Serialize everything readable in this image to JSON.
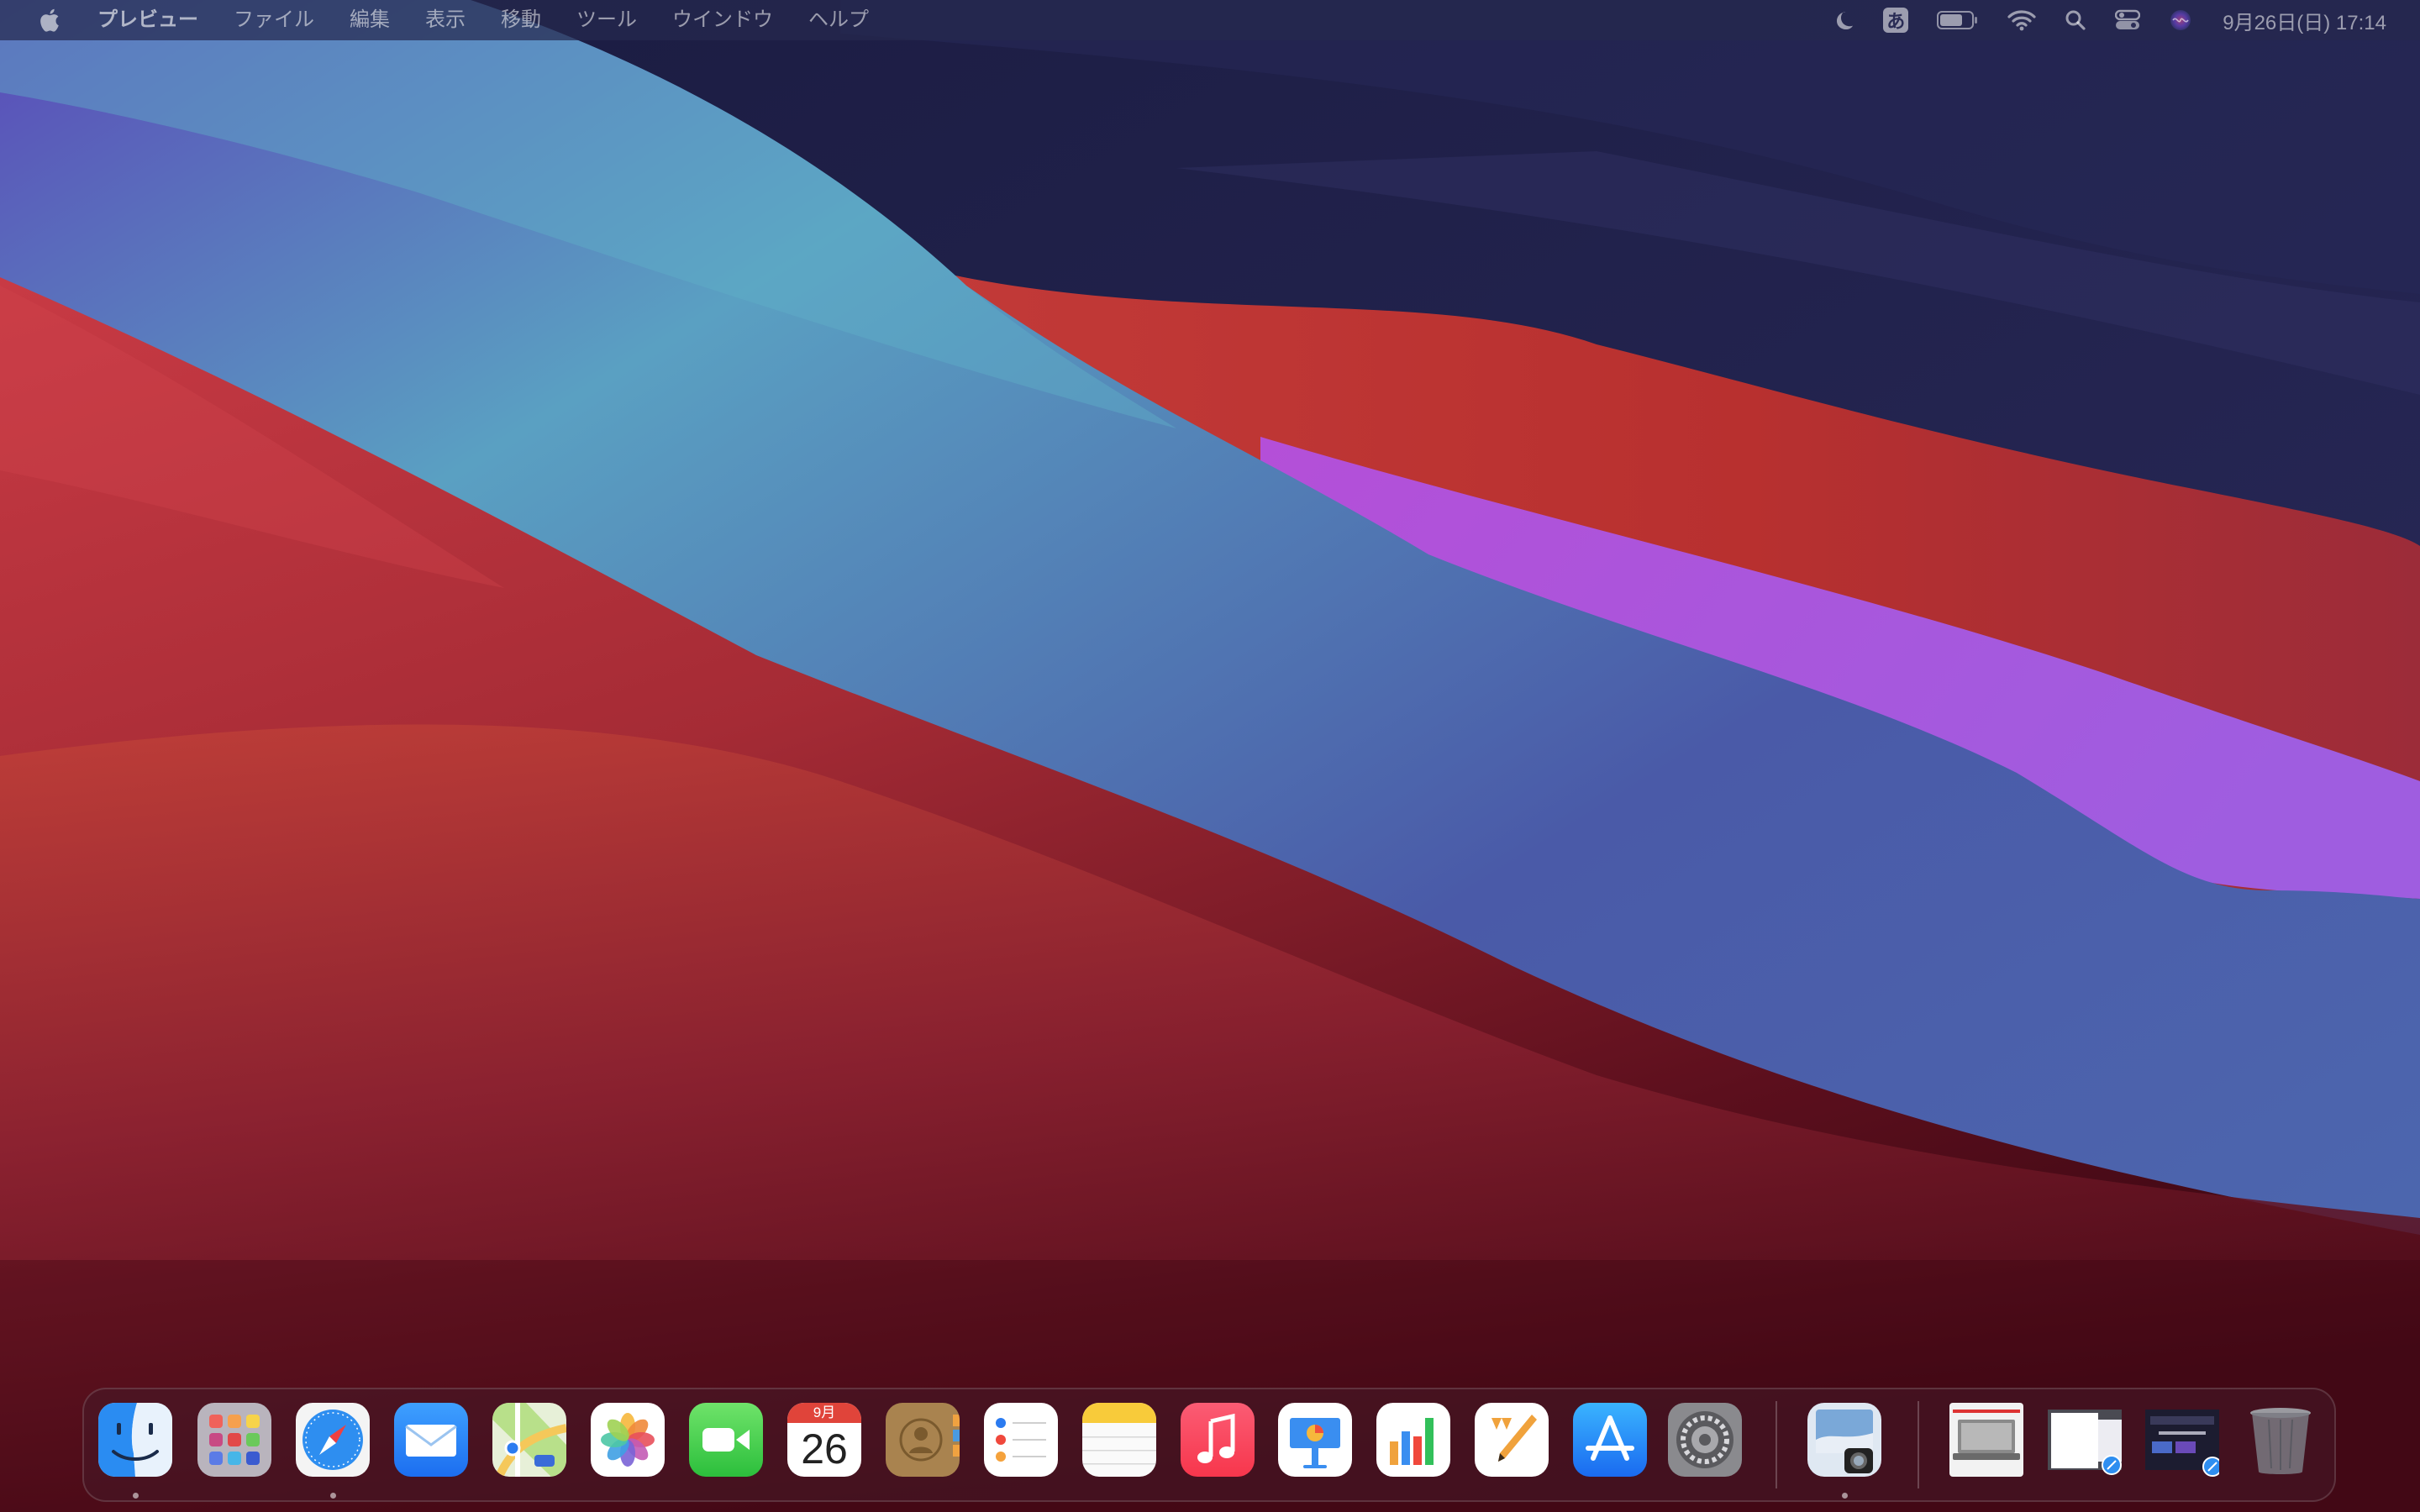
{
  "menubar": {
    "apple_icon": "apple-logo-icon",
    "app_name": "プレビュー",
    "menus": [
      "ファイル",
      "編集",
      "表示",
      "移動",
      "ツール",
      "ウインドウ",
      "ヘルプ"
    ],
    "status": {
      "focus_icon": "moon-icon",
      "input_method": "あ",
      "battery_icon": "battery-icon",
      "wifi_icon": "wifi-icon",
      "search_icon": "magnifier-icon",
      "control_center_icon": "control-center-icon",
      "siri_icon": "siri-icon",
      "clock": "9月26日(日)  17:14"
    }
  },
  "dock": {
    "apps": [
      {
        "name": "Finder",
        "icon": "finder-icon",
        "running": true
      },
      {
        "name": "Launchpad",
        "icon": "launchpad-icon",
        "running": false
      },
      {
        "name": "Safari",
        "icon": "safari-icon",
        "running": true
      },
      {
        "name": "Mail",
        "icon": "mail-icon",
        "running": false
      },
      {
        "name": "Maps",
        "icon": "maps-icon",
        "running": false
      },
      {
        "name": "Photos",
        "icon": "photos-icon",
        "running": false
      },
      {
        "name": "FaceTime",
        "icon": "facetime-icon",
        "running": false
      },
      {
        "name": "Calendar",
        "icon": "calendar-icon",
        "running": false
      },
      {
        "name": "Contacts",
        "icon": "contacts-icon",
        "running": false
      },
      {
        "name": "Reminders",
        "icon": "reminders-icon",
        "running": false
      },
      {
        "name": "Notes",
        "icon": "notes-icon",
        "running": false
      },
      {
        "name": "Music",
        "icon": "music-icon",
        "running": false
      },
      {
        "name": "Keynote",
        "icon": "keynote-icon",
        "running": false
      },
      {
        "name": "Numbers",
        "icon": "numbers-icon",
        "running": false
      },
      {
        "name": "Pages",
        "icon": "pages-icon",
        "running": false
      },
      {
        "name": "App Store",
        "icon": "app-store-icon",
        "running": false
      },
      {
        "name": "System Preferences",
        "icon": "gear-icon",
        "running": false
      }
    ],
    "calendar": {
      "month": "9月",
      "day": "26"
    },
    "recent_app": {
      "name": "Preview",
      "icon": "preview-icon"
    },
    "stack_items": [
      {
        "icon": "laptop-thumbnail-icon"
      },
      {
        "icon": "document-thumbnail-icon"
      },
      {
        "icon": "webpage-thumbnail-icon"
      }
    ],
    "trash": {
      "icon": "trash-icon"
    }
  },
  "colors": {
    "menubar": "#26284e",
    "accent_blue": "#5aa4c6",
    "accent_red": "#b83232",
    "accent_purple": "#9b55d8",
    "night": "#1c1d44"
  }
}
